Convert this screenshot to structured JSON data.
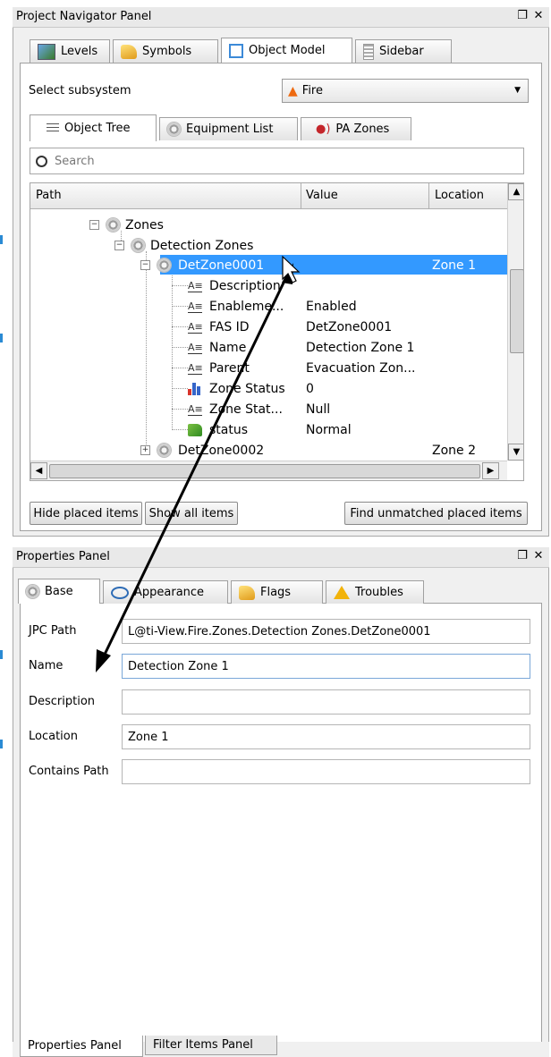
{
  "navigator": {
    "title": "Project Navigator Panel",
    "float_icon": "❐",
    "close_icon": "✕",
    "tabs": [
      {
        "label": "Levels",
        "icon": "levels-icon"
      },
      {
        "label": "Symbols",
        "icon": "symbols-icon"
      },
      {
        "label": "Object Model",
        "icon": "object-model-icon",
        "active": true
      },
      {
        "label": "Sidebar",
        "icon": "sidebar-icon"
      }
    ],
    "subsystem_label": "Select subsystem",
    "subsystem_value": "Fire",
    "subtabs": [
      {
        "label": "Object Tree",
        "active": true
      },
      {
        "label": "Equipment List"
      },
      {
        "label": "PA Zones"
      }
    ],
    "search_placeholder": "Search",
    "columns": {
      "path": "Path",
      "value": "Value",
      "location": "Location"
    },
    "tree": [
      {
        "label": "Zones",
        "value": "",
        "location": ""
      },
      {
        "label": "Detection Zones",
        "value": "",
        "location": ""
      },
      {
        "label": "DetZone0001",
        "value": "",
        "location": "Zone 1"
      },
      {
        "label": "Description",
        "value": "",
        "location": ""
      },
      {
        "label": "Enableme...",
        "value": "Enabled",
        "location": ""
      },
      {
        "label": "FAS ID",
        "value": "DetZone0001",
        "location": ""
      },
      {
        "label": "Name",
        "value": "Detection Zone 1",
        "location": ""
      },
      {
        "label": "Parent",
        "value": "Evacuation Zon...",
        "location": ""
      },
      {
        "label": "Zone Status",
        "value": "0",
        "location": ""
      },
      {
        "label": "Zone Stat...",
        "value": "Null",
        "location": ""
      },
      {
        "label": "status",
        "value": "Normal",
        "location": ""
      },
      {
        "label": "DetZone0002",
        "value": "",
        "location": "Zone 2"
      }
    ],
    "buttons": {
      "hide_placed": "Hide placed items",
      "show_all": "Show all items",
      "find_unmatched": "Find unmatched placed items"
    }
  },
  "properties": {
    "title": "Properties Panel",
    "float_icon": "❐",
    "close_icon": "✕",
    "tabs": [
      {
        "label": "Base",
        "active": true
      },
      {
        "label": "Appearance"
      },
      {
        "label": "Flags"
      },
      {
        "label": "Troubles"
      }
    ],
    "fields": {
      "jpc_path": {
        "label": "JPC Path",
        "value": "L@ti-View.Fire.Zones.Detection Zones.DetZone0001"
      },
      "name": {
        "label": "Name",
        "value": "Detection Zone 1"
      },
      "description": {
        "label": "Description",
        "value": ""
      },
      "location": {
        "label": "Location",
        "value": "Zone 1"
      },
      "contains_path": {
        "label": "Contains Path",
        "value": ""
      }
    }
  },
  "bottom_tabs": [
    {
      "label": "Properties Panel",
      "active": true
    },
    {
      "label": "Filter Items Panel"
    }
  ],
  "colors": {
    "selection": "#3399ff",
    "accent_marker": "#2a8ad4"
  }
}
